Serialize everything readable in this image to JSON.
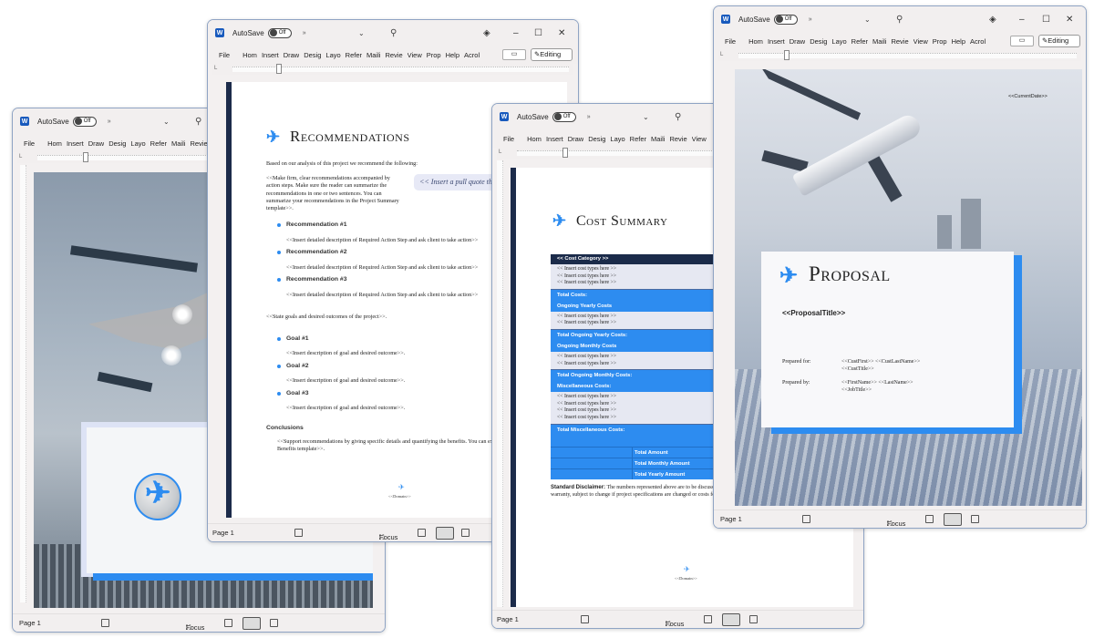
{
  "common": {
    "autosave_label": "AutoSave",
    "autosave_state": "Off",
    "more_glyph": "»",
    "ribbon_tabs": [
      "File",
      "Home",
      "Insert",
      "Draw",
      "Design",
      "Layout",
      "References",
      "Mailings",
      "Review",
      "View",
      "Properties",
      "Help",
      "Acrobat"
    ],
    "ribbon_tabs_truncated": [
      "File",
      "Hom",
      "Insert",
      "Draw",
      "Desig",
      "Layo",
      "Refer",
      "Maili",
      "Revie",
      "View",
      "Prop",
      "Help",
      "Acrol"
    ],
    "editing_label": "Editing",
    "page_label": "Page 1",
    "focus_label": "Focus",
    "icons": {
      "app": "word-icon",
      "search": "search-icon",
      "copilot": "diamond-icon",
      "minimize": "minimize-icon",
      "maximize": "maximize-icon",
      "close": "close-icon",
      "comment": "comment-icon",
      "pencil": "pencil-icon"
    }
  },
  "window_cover": {
    "domain_partial": "<<"
  },
  "window_recommendations": {
    "title": "Recommendations",
    "intro": "Based on our analysis of this project we recommend the following:",
    "instruction": "<<Make firm, clear recommendations accompanied by action steps.  Make sure the reader can summarize the recommendations in one or two sentences.  You can summarize your recommendations in the Project Summary template>>.",
    "pull_quote": "<< Insert a pull quote that will be in emphasis text >>",
    "recommendations": [
      {
        "heading": "Recommendation #1",
        "desc": "<<Insert detailed description of Required Action Step and ask client to take action>>"
      },
      {
        "heading": "Recommendation #2",
        "desc": "<<Insert detailed description of Required Action Step and ask client to take action>>"
      },
      {
        "heading": "Recommendation #3",
        "desc": "<<Insert detailed description of Required Action Step and ask client to take action>>"
      }
    ],
    "goals_intro": "<<State goals and desired outcomes of the project>>.",
    "goals": [
      {
        "heading": "Goal #1",
        "desc": "<<Insert description of goal and desired outcome>>."
      },
      {
        "heading": "Goal #2",
        "desc": "<<Insert description of goal and desired outcome>>."
      },
      {
        "heading": "Goal #3",
        "desc": "<<Insert description of goal and desired outcome>>."
      }
    ],
    "conclusions_heading": "Conclusions",
    "conclusions_text": "<<Support recommendations by giving specific details and quantifying the benefits.  You can expand on the benefits by adding the Benefits template>>.",
    "domain": "<<Domain>>"
  },
  "window_cost_summary": {
    "title": "Cost Summary",
    "table": {
      "header": "<< Cost Category >>",
      "insert_text": "<< Insert cost types here >>",
      "sections": [
        {
          "items": 3,
          "total": "Total Costs:",
          "next": "Ongoing Yearly Costs"
        },
        {
          "items": 2,
          "total": "Total Ongoing Yearly Costs:",
          "next": "Ongoing Monthly Costs"
        },
        {
          "items": 2,
          "total": "Total Ongoing Monthly Costs:",
          "next": "Miscellaneous Costs:"
        },
        {
          "items": 4,
          "total": "Total Miscellaneous Costs:",
          "next": ""
        }
      ],
      "totals": [
        "Total Amount",
        "Total Monthly Amount",
        "Total Yearly Amount"
      ]
    },
    "disclaimer_label": "Standard Disclaimer:",
    "disclaimer_text": "The numbers represented above are to be discussed. The above Cost Summary does in no way constitute a warranty, subject to change if project specifications are changed or costs for being locked in by a binding contract.",
    "domain": "<<Domain>>"
  },
  "window_proposal": {
    "current_date": "<<CurrentDate>>",
    "title": "Proposal",
    "proposal_title": "<<ProposalTitle>>",
    "prepared_for_label": "Prepared for:",
    "prepared_for_name": "<<CustFirst>> <<CustLastName>>",
    "prepared_for_title": "<<CustTitle>>",
    "prepared_by_label": "Prepared by:",
    "prepared_by_name": "<<FirstName>> <<LastName>>",
    "prepared_by_title": "<<JobTitle>>"
  }
}
